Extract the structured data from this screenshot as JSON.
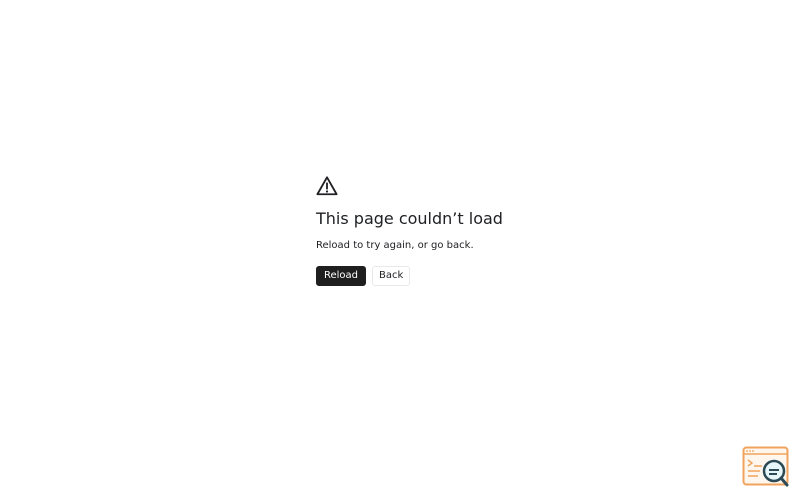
{
  "error": {
    "icon": "warning-triangle-icon",
    "title": "This page couldn’t load",
    "message": "Reload to try again, or go back.",
    "reload_label": "Reload",
    "back_label": "Back"
  },
  "badge": {
    "icon": "browser-search-icon",
    "accent_color": "#f0a35c"
  },
  "colors": {
    "primary_button": "#1f1f1f",
    "text": "#202124"
  }
}
